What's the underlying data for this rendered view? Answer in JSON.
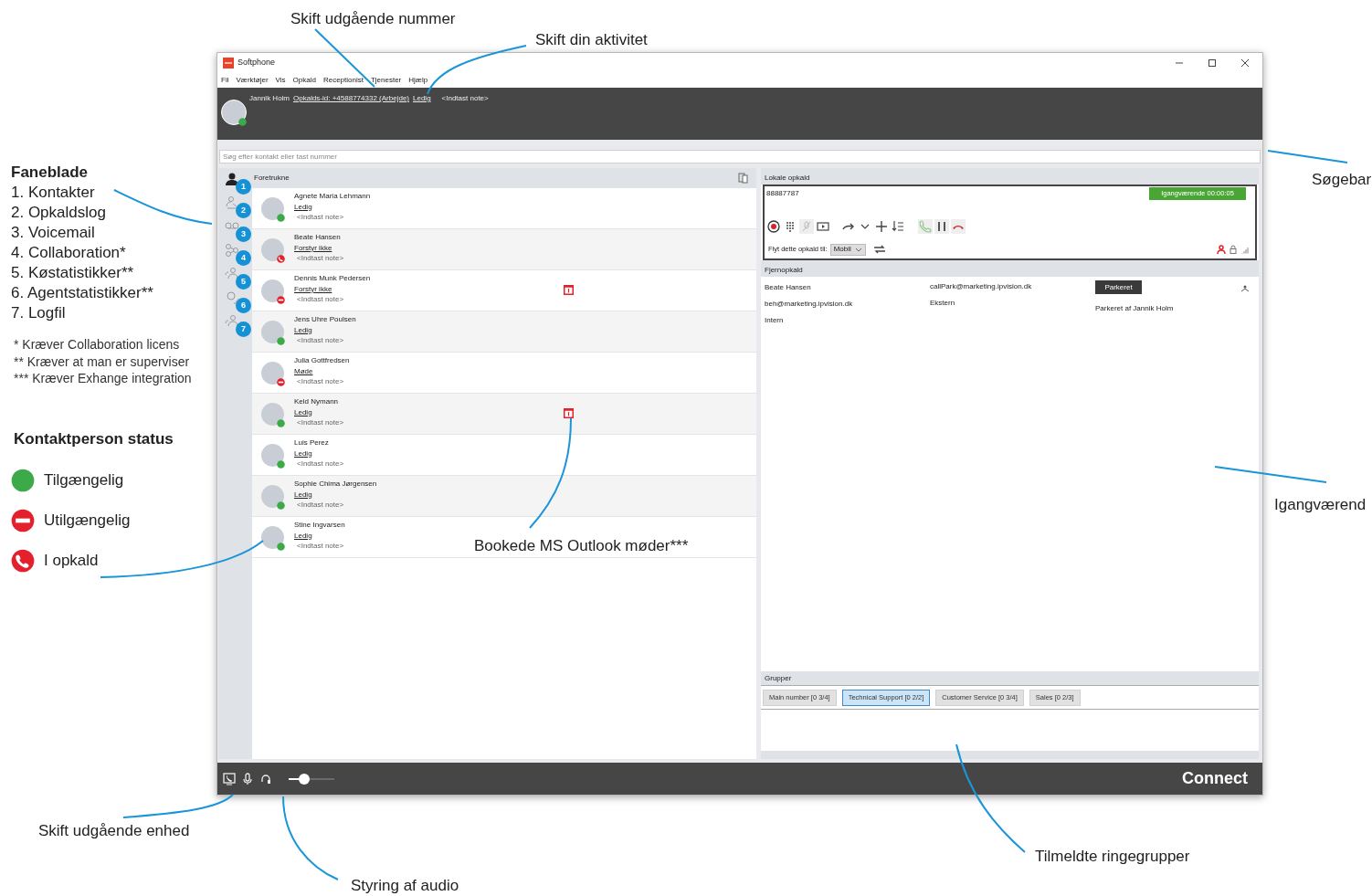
{
  "window": {
    "title": "Softphone",
    "menu": [
      "Fil",
      "Værktøjer",
      "Vis",
      "Opkald",
      "Receptionist",
      "Tjenester",
      "Hjælp"
    ]
  },
  "header": {
    "user": "Jannik Holm",
    "caller_id": "Opkalds-id: +4588774332 (Arbejde)",
    "activity": "Ledig",
    "note": "<Indtast note>",
    "kind": "available"
  },
  "search": {
    "placeholder": "Søg efter kontakt eller tast nummer"
  },
  "tabs": [
    {
      "kind": "contacts",
      "badge": "1",
      "selected": true
    },
    {
      "kind": "call_log",
      "badge": "2",
      "selected": false
    },
    {
      "kind": "voicemail",
      "badge": "3",
      "selected": false
    },
    {
      "kind": "collaboration",
      "badge": "4",
      "selected": false
    },
    {
      "kind": "queue_stats",
      "badge": "5",
      "selected": false
    },
    {
      "kind": "agent_stats",
      "badge": "6",
      "selected": false
    },
    {
      "kind": "log",
      "badge": "7",
      "selected": false
    }
  ],
  "contacts": {
    "title": "Foretrukne",
    "items": [
      {
        "name": "Agnete Maria Lehmann",
        "activity": "Ledig",
        "note": "<Indtast note>",
        "kind": "available",
        "meeting": false
      },
      {
        "name": "Beate Hansen",
        "activity": "Forstyr ikke",
        "note": "<Indtast note>",
        "kind": "in_call",
        "meeting": false
      },
      {
        "name": "Dennis Munk Pedersen",
        "activity": "Forstyr ikke",
        "note": "<Indtast note>",
        "kind": "unavailable",
        "meeting": true
      },
      {
        "name": "Jens Uhre Poulsen",
        "activity": "Ledig",
        "note": "<Indtast note>",
        "kind": "available",
        "meeting": false
      },
      {
        "name": "Julia Gottfredsen",
        "activity": "Møde",
        "note": "<Indtast note>",
        "kind": "unavailable",
        "meeting": false
      },
      {
        "name": "Keld Nymann",
        "activity": "Ledig",
        "note": "<Indtast note>",
        "kind": "available",
        "meeting": true
      },
      {
        "name": "Luis Perez",
        "activity": "Ledig",
        "note": "<Indtast note>",
        "kind": "available",
        "meeting": false
      },
      {
        "name": "Sophie Chima Jørgensen",
        "activity": "Ledig",
        "note": "<Indtast note>",
        "kind": "available",
        "meeting": false
      },
      {
        "name": "Stine Ingvarsen",
        "activity": "Ledig",
        "note": "<Indtast note>",
        "kind": "available",
        "meeting": false
      }
    ]
  },
  "local_calls": {
    "title": "Lokale opkald",
    "number": "88887787",
    "state": "Igangværende 00:00:05",
    "move_label": "Flyt dette opkald til:",
    "move_target": "Mobil"
  },
  "remote_calls": {
    "title": "Fjernopkald",
    "rows": [
      {
        "column_1": [
          "Beate Hansen",
          "beh@marketing.ipvision.dk",
          "Intern"
        ],
        "column_2": [
          "callPark@marketing.ipvision.dk",
          "Ekstern"
        ],
        "badge": "Parkeret",
        "parked_by": "Parkeret af Jannik Holm"
      }
    ]
  },
  "groups": {
    "title": "Grupper",
    "items": [
      {
        "label": "Main number [0 3/4]",
        "selected": false
      },
      {
        "label": "Technical Support [0 2/2]",
        "selected": true
      },
      {
        "label": "Customer Service [0 3/4]",
        "selected": false
      },
      {
        "label": "Sales [0 2/3]",
        "selected": false
      }
    ]
  },
  "bottom_bar": {
    "volume": {
      "level": 0.33
    },
    "brand": "Connect"
  },
  "annotations": {
    "tabs_legend": {
      "title": "Faneblade",
      "items": [
        "1. Kontakter",
        "2. Opkaldslog",
        "3. Voicemail",
        "4. Collaboration*",
        "5. Køstatistikker**",
        "6. Agentstatistikker**",
        "7. Logfil"
      ],
      "footnotes": [
        "* Kræver Collaboration licens",
        "** Kræver at man er superviser",
        "*** Kræver Exhange integration"
      ]
    },
    "status_legend": {
      "title": "Kontaktperson status",
      "items": [
        {
          "kind": "available",
          "label": "Tilgængelig"
        },
        {
          "kind": "unavailable",
          "label": "Utilgængelig"
        },
        {
          "kind": "in_call",
          "label": "I opkald"
        }
      ]
    },
    "callouts": [
      "Skift udgående nummer",
      "Skift din aktivitet",
      "Søgebar",
      "Igangværend",
      "Bookede MS Outlook møder***",
      "Tilmeldte ringegrupper",
      "Skift udgående enhed",
      "Styring af audio"
    ]
  }
}
